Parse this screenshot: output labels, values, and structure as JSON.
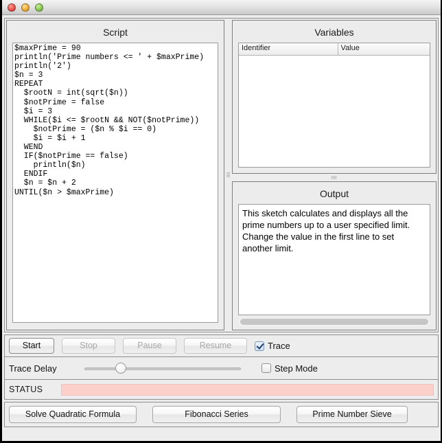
{
  "titlebar": {
    "close_label": "",
    "minimize_label": "",
    "maximize_label": ""
  },
  "script_panel": {
    "title": "Script",
    "code": "$maxPrime = 90\nprintln('Prime numbers <= ' + $maxPrime)\nprintln('2')\n$n = 3\nREPEAT\n  $rootN = int(sqrt($n))\n  $notPrime = false\n  $i = 3\n  WHILE($i <= $rootN && NOT($notPrime))\n    $notPrime = ($n % $i == 0)\n    $i = $i + 1\n  WEND\n  IF($notPrime == false)\n    println($n)\n  ENDIF\n  $n = $n + 2\nUNTIL($n > $maxPrime)"
  },
  "variables_panel": {
    "title": "Variables",
    "columns": [
      "Identifier",
      "Value"
    ],
    "rows": []
  },
  "output_panel": {
    "title": "Output",
    "text": "This sketch calculates and displays all the prime numbers up to a user specified limit. Change the value in the first line to set another limit."
  },
  "controls": {
    "start_label": "Start",
    "stop_label": "Stop",
    "pause_label": "Pause",
    "resume_label": "Resume",
    "trace_label": "Trace",
    "trace_checked": true
  },
  "delay_row": {
    "label": "Trace Delay",
    "slider_value_percent": 21,
    "step_mode_label": "Step Mode",
    "step_mode_checked": false
  },
  "status_row": {
    "label": "STATUS",
    "message": "",
    "field_color": "#fbcfca"
  },
  "samples_row": {
    "quadratic_label": "Solve Quadratic Formula",
    "fibonacci_label": "Fibonacci Series",
    "prime_label": "Prime Number Sieve"
  }
}
